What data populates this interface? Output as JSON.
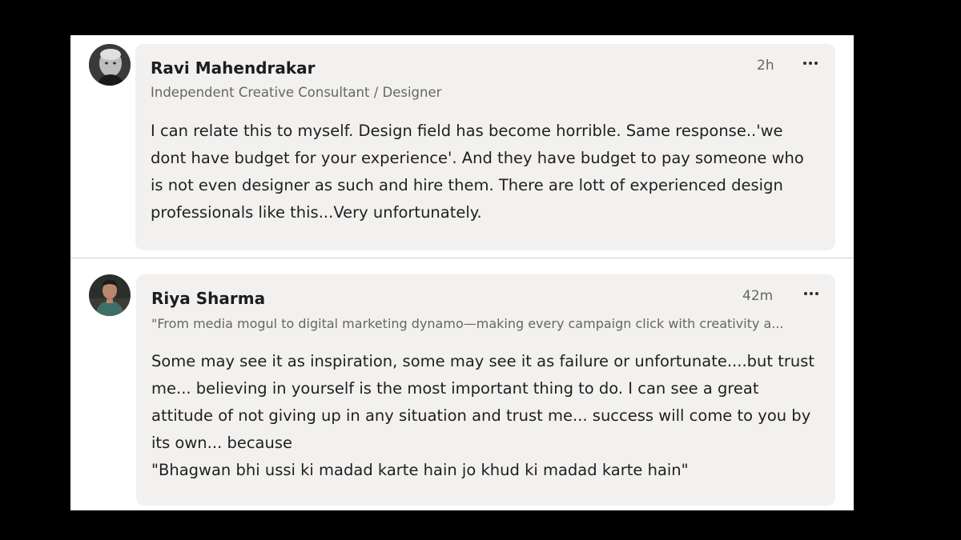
{
  "comments": [
    {
      "author": "Ravi Mahendrakar",
      "headline": "Independent Creative Consultant / Designer",
      "time": "2h",
      "more_label": "...",
      "avatar": "grayscale-portrait",
      "text_lines": [
        "I can relate this to myself. Design field has become horrible. Same response..'we",
        "dont have budget for your experience'. And they have budget to pay someone who",
        "is not even designer as such and hire them. There are lott of experienced design",
        "professionals like this...Very unfortunately."
      ]
    },
    {
      "author": "Riya Sharma",
      "headline": "\"From media mogul to digital marketing dynamo—making every campaign click with creativity a...",
      "time": "42m",
      "more_label": "...",
      "avatar": "color-portrait",
      "text_lines": [
        "Some may see it as inspiration, some may see it as failure or unfortunate....but trust",
        "me... believing in yourself is the most important thing to do. I can see a great",
        "attitude of not giving up in any situation and trust me... success will come to you by",
        "its own... because",
        "\"Bhagwan bhi ussi ki madad karte hain jo khud ki madad karte hain\""
      ]
    }
  ],
  "colors": {
    "background": "#000000",
    "panel": "#ffffff",
    "bubble": "#f2f1ef",
    "name": "#1d1d1d",
    "muted": "#666666",
    "body": "#1f1f1f"
  }
}
